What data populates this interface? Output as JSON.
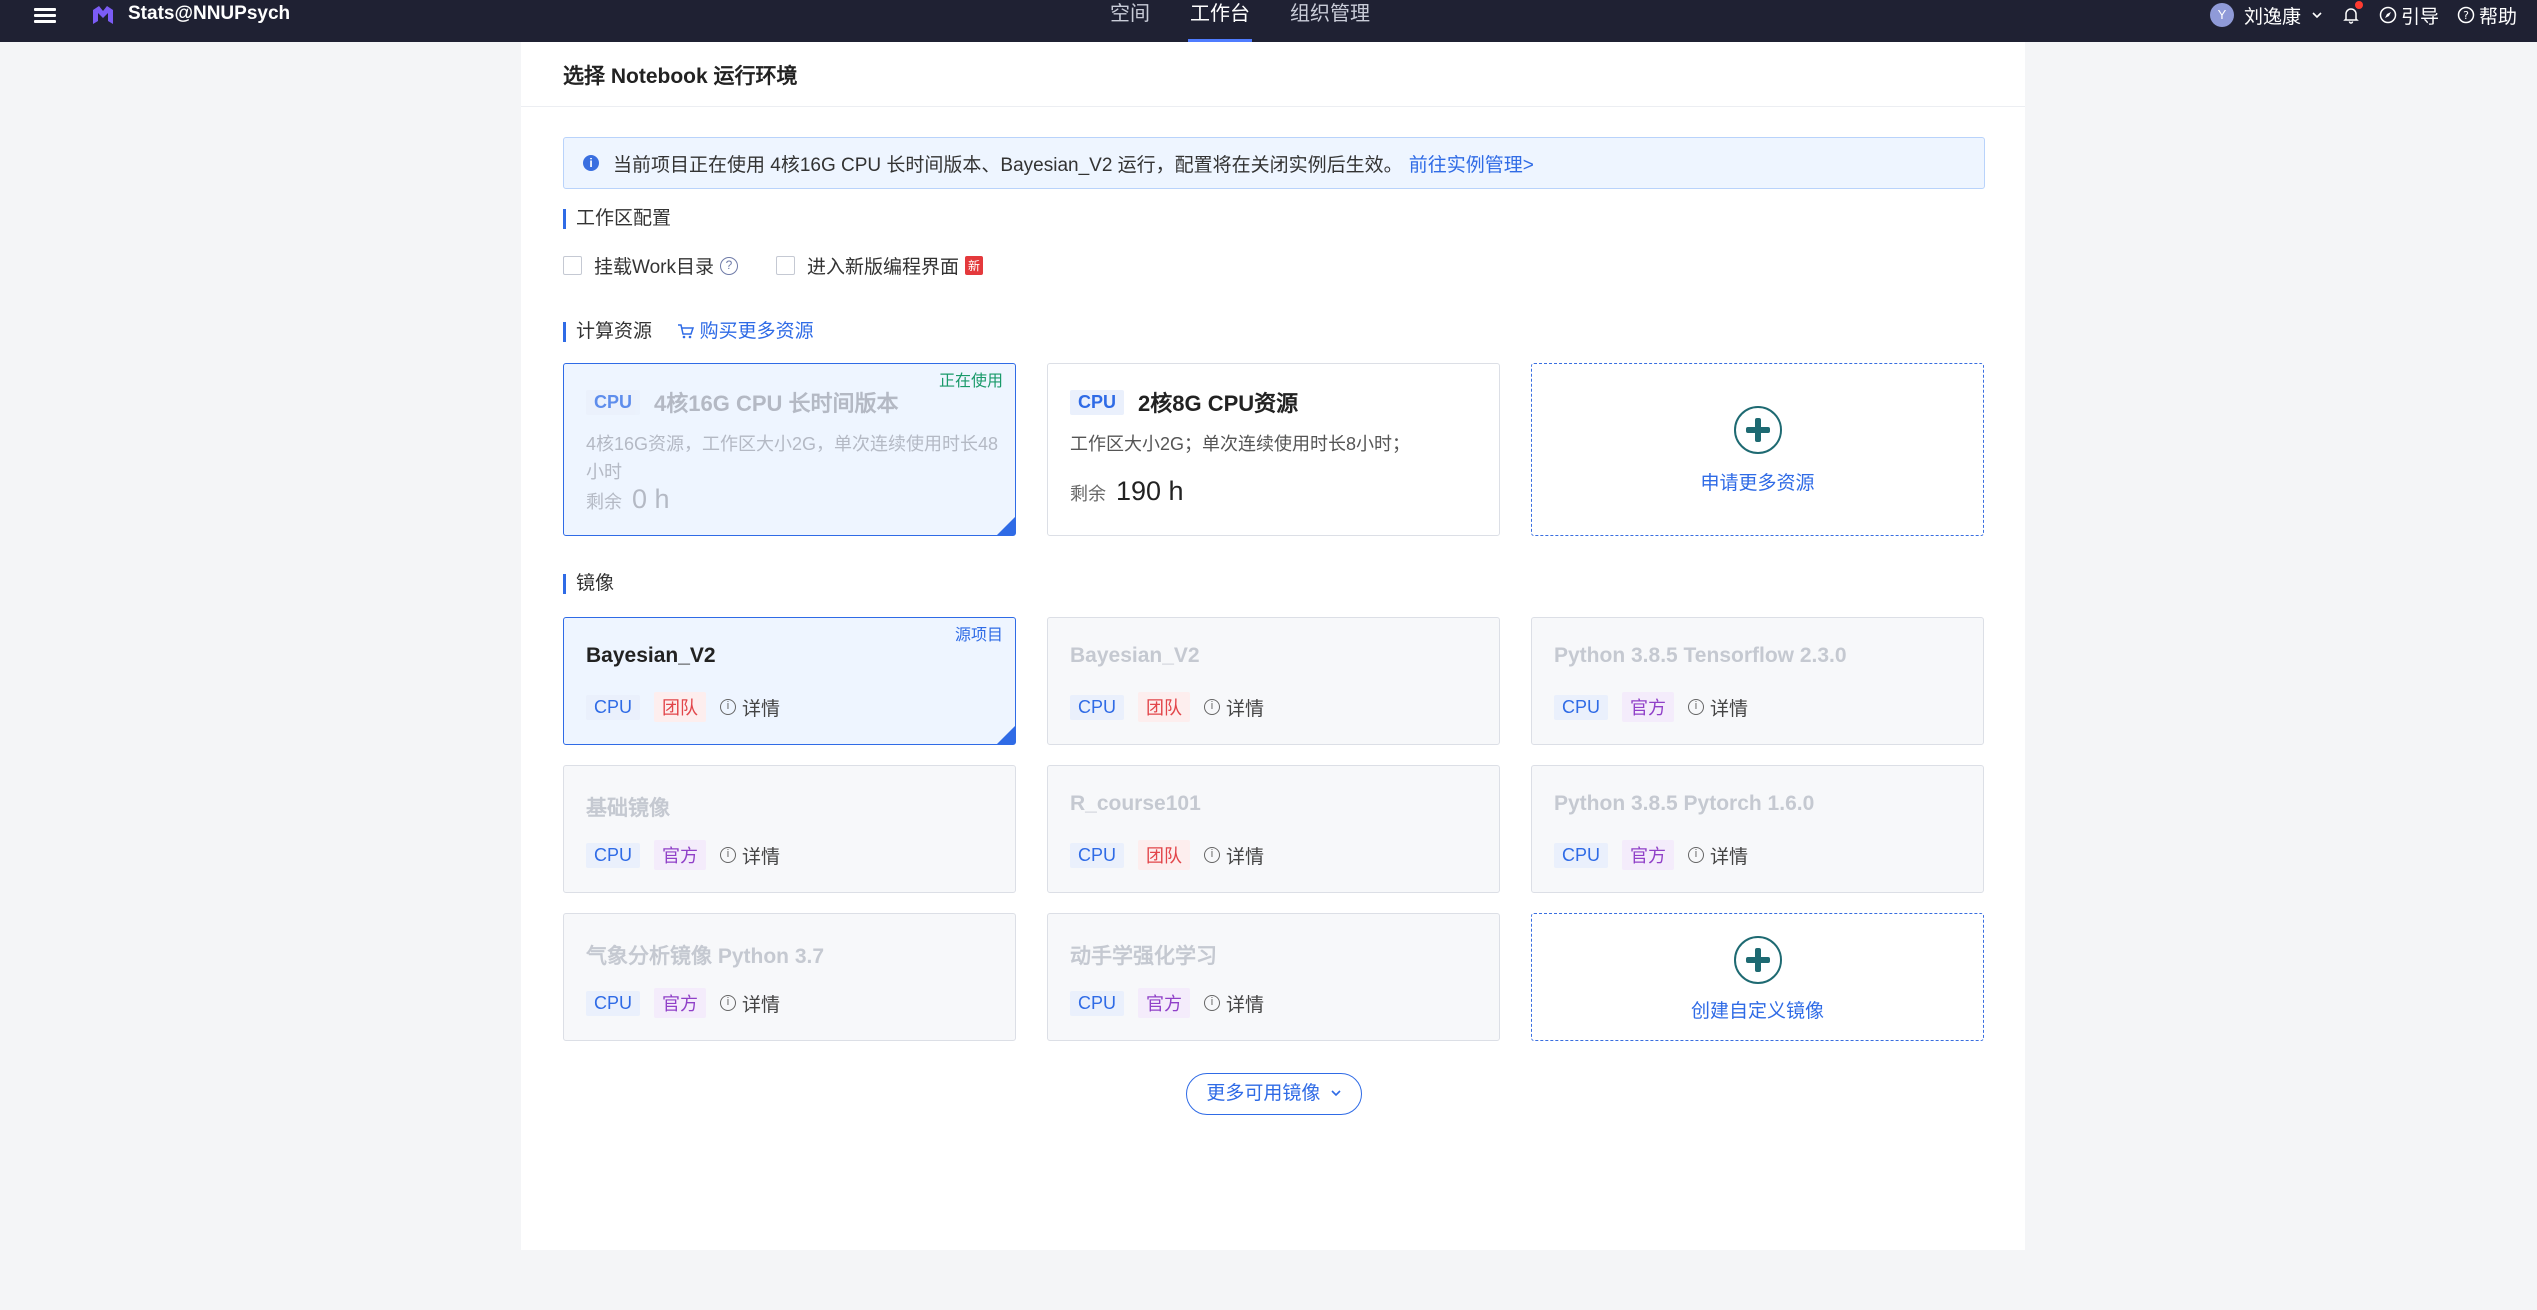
{
  "header": {
    "brand": "Stats@NNUPsych",
    "tabs": [
      {
        "label": "空间"
      },
      {
        "label": "工作台"
      },
      {
        "label": "组织管理"
      }
    ],
    "avatar_initial": "Y",
    "user_name": "刘逸康",
    "guide_label": "引导",
    "help_label": "帮助"
  },
  "page": {
    "title": "选择 Notebook 运行环境",
    "notice": {
      "icon": "info-icon",
      "text": "当前项目正在使用 4核16G CPU 长时间版本、Bayesian_V2 运行，配置将在关闭实例后生效。",
      "link": "前往实例管理>"
    },
    "workspace": {
      "title": "工作区配置",
      "mount_label": "挂载Work目录",
      "new_ui_label": "进入新版编程界面",
      "new_badge": "新"
    },
    "compute": {
      "title": "计算资源",
      "buy_label": "购买更多资源",
      "resources": [
        {
          "tag": "CPU",
          "name": "4核16G CPU 长时间版本",
          "desc": "4核16G资源，工作区大小2G，单次连续使用时长48小时",
          "remain_label": "剩余",
          "remain": "0 h",
          "status": "正在使用"
        },
        {
          "tag": "CPU",
          "name": "2核8G CPU资源",
          "desc": "工作区大小2G；单次连续使用时长8小时；",
          "remain_label": "剩余",
          "remain": "190 h"
        }
      ],
      "apply_label": "申请更多资源"
    },
    "images": {
      "title": "镜像",
      "source_tag": "源项目",
      "detail_label": "详情",
      "items": [
        {
          "name": "Bayesian_V2",
          "hw": "CPU",
          "type": "团队"
        },
        {
          "name": "Bayesian_V2",
          "hw": "CPU",
          "type": "团队"
        },
        {
          "name": "Python 3.8.5 Tensorflow 2.3.0",
          "hw": "CPU",
          "type": "官方"
        },
        {
          "name": "基础镜像",
          "hw": "CPU",
          "type": "官方"
        },
        {
          "name": "R_course101",
          "hw": "CPU",
          "type": "团队"
        },
        {
          "name": "Python 3.8.5 Pytorch 1.6.0",
          "hw": "CPU",
          "type": "官方"
        },
        {
          "name": "气象分析镜像 Python 3.7",
          "hw": "CPU",
          "type": "官方"
        },
        {
          "name": "动手学强化学习",
          "hw": "CPU",
          "type": "官方"
        }
      ],
      "create_label": "创建自定义镜像",
      "more_label": "更多可用镜像"
    }
  },
  "colors": {
    "topbar": "#1f2133",
    "accent": "#2f6be6",
    "team": "#e2454a",
    "official": "#9040c8",
    "running": "#1a9a6a"
  }
}
